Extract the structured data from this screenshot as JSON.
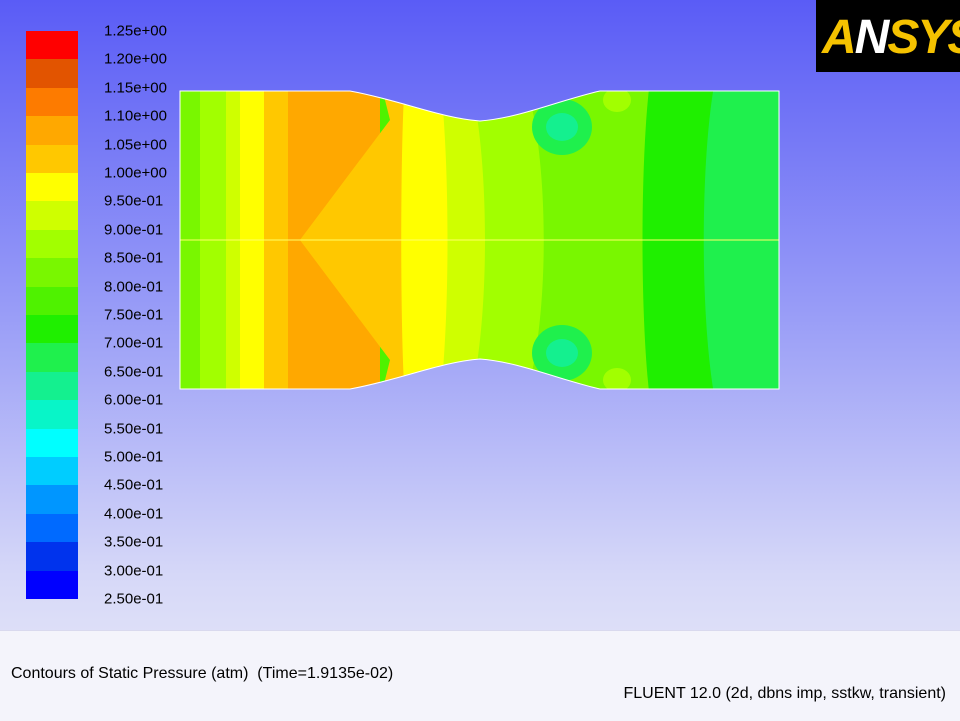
{
  "logo": {
    "text": "ANSYS"
  },
  "footer": {
    "plot_title": "Contours of Static Pressure (atm)  (Time=1.9135e-02)",
    "solver_info": "FLUENT 12.0 (2d, dbns imp, sstkw, transient)"
  },
  "chart_data": {
    "type": "heatmap",
    "title": "Contours of Static Pressure (atm)  (Time=1.9135e-02)",
    "colorbar": {
      "min": 0.25,
      "max": 1.25,
      "tick_labels": [
        "1.25e+00",
        "1.20e+00",
        "1.15e+00",
        "1.10e+00",
        "1.05e+00",
        "1.00e+00",
        "9.50e-01",
        "9.00e-01",
        "8.50e-01",
        "8.00e-01",
        "7.50e-01",
        "7.00e-01",
        "6.50e-01",
        "6.00e-01",
        "5.50e-01",
        "5.00e-01",
        "4.50e-01",
        "4.00e-01",
        "3.50e-01",
        "3.00e-01",
        "2.50e-01"
      ],
      "colors": [
        "#ff0000",
        "#e25400",
        "#fd7b00",
        "#ffa800",
        "#ffc800",
        "#ffff00",
        "#cfff00",
        "#a2ff00",
        "#79f700",
        "#4ff200",
        "#1fef00",
        "#1ff04d",
        "#14f08f",
        "#08f5c8",
        "#00ffff",
        "#00cdff",
        "#0096ff",
        "#006aff",
        "#0033ed",
        "#0000ff"
      ]
    },
    "field": {
      "description": "2D static pressure field in a converging-diverging duct, symmetric about centerline",
      "levels_left_to_right": [
        0.78,
        0.86,
        0.95,
        1.03,
        0.95,
        0.9,
        0.85,
        0.76,
        0.72,
        0.76
      ]
    }
  }
}
